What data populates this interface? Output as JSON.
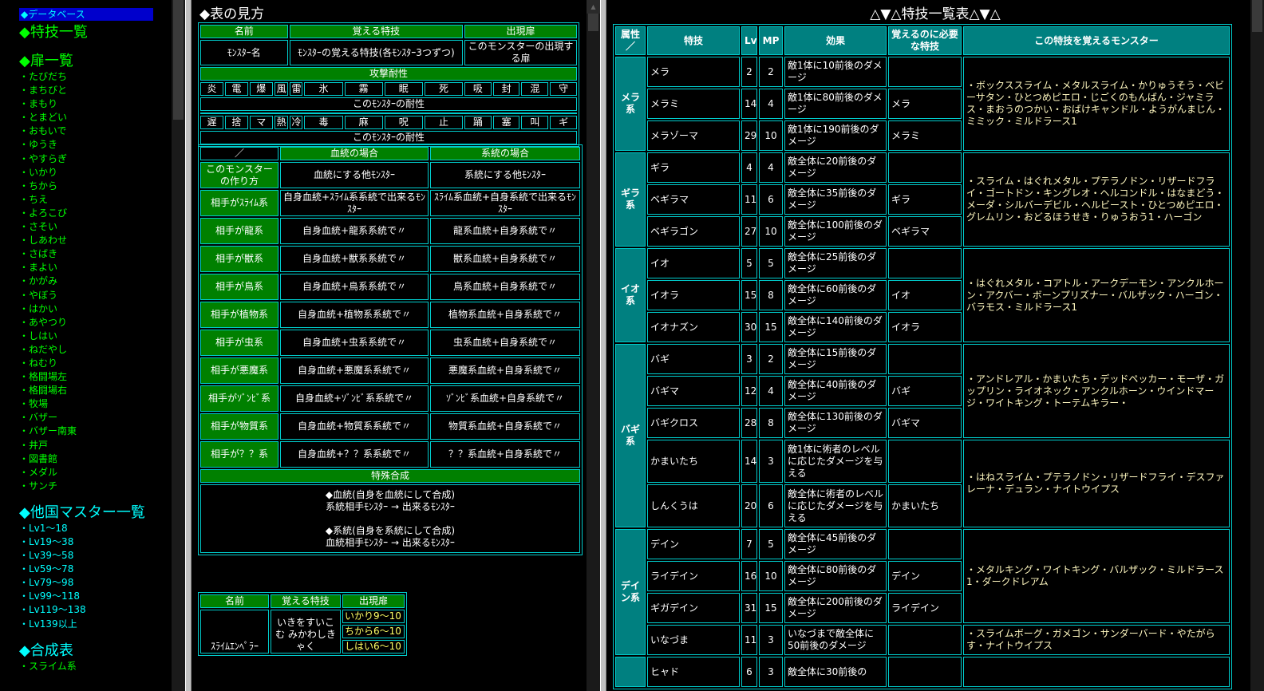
{
  "sidebar": {
    "selected": "◆データベース",
    "skills_head": "◆特技一覧",
    "doors_head": "◆扉一覧",
    "doors": [
      "・たびだち",
      "・まちびと",
      "・まもり",
      "・とまどい",
      "・おもいで",
      "・ゆうき",
      "・やすらぎ",
      "・いかり",
      "・ちから",
      "・ちえ",
      "・よろこび",
      "・さそい",
      "・しあわせ",
      "・さばき",
      "・まよい",
      "・かがみ",
      "・やぼう",
      "・はかい",
      "・あやつり",
      "・しはい",
      "・ねだやし",
      "・ねむり",
      "・格闘場左",
      "・格闘場右",
      "・牧場",
      "・バザー",
      "・バザー南東",
      "・井戸",
      "・図書館",
      "・メダル",
      "・サンチ"
    ],
    "masters_head": "◆他国マスター一覧",
    "masters": [
      "・Lv1～18",
      "・Lv19～38",
      "・Lv39～58",
      "・Lv59～78",
      "・Lv79～98",
      "・Lv99～118",
      "・Lv119～138",
      "・Lv139以上"
    ],
    "synth_head": "◆合成表",
    "synth": [
      "・スライム系"
    ]
  },
  "legend": {
    "title": "◆表の見方",
    "h_name": "名前",
    "h_skill": "覚える特技",
    "h_door": "出現扉",
    "c_name": "ﾓﾝｽﾀｰ名",
    "c_skill": "ﾓﾝｽﾀｰの覚える特技(各ﾓﾝｽﾀｰ3つずつ)",
    "c_door": "このモンスターの出現する扉",
    "attack_res": "攻撃耐性",
    "attack_cells": [
      "炎",
      "電",
      "爆",
      "風",
      "雷",
      "氷",
      "霧",
      "眠",
      "死",
      "吸",
      "封",
      "混",
      "守"
    ],
    "res_label": "このﾓﾝｽﾀｰの耐性",
    "status_cells": [
      "遅",
      "捨",
      "マ",
      "熱",
      "冷",
      "毒",
      "麻",
      "呪",
      "止",
      "踊",
      "塞",
      "叫",
      "ギ"
    ],
    "res_label2": "このﾓﾝｽﾀｰの耐性",
    "slash": "／",
    "h_blood": "血統の場合",
    "h_line": "系統の場合",
    "make_label": "このモンスターの作り方",
    "make_blood": "血統にする他ﾓﾝｽﾀｰ",
    "make_line": "系統にする他ﾓﾝｽﾀｰ",
    "rows": [
      {
        "label": "相手がｽﾗｲﾑ系",
        "blood": "自身血統+ｽﾗｲﾑ系系統で出来るﾓﾝｽﾀｰ",
        "line": "ｽﾗｲﾑ系血統+自身系統で出来るﾓﾝｽﾀｰ"
      },
      {
        "label": "相手が龍系",
        "blood": "自身血統+龍系系統で〃",
        "line": "龍系血統+自身系統で〃"
      },
      {
        "label": "相手が獣系",
        "blood": "自身血統+獣系系統で〃",
        "line": "獣系血統+自身系統で〃"
      },
      {
        "label": "相手が鳥系",
        "blood": "自身血統+鳥系系統で〃",
        "line": "鳥系血統+自身系統で〃"
      },
      {
        "label": "相手が植物系",
        "blood": "自身血統+植物系系統で〃",
        "line": "植物系血統+自身系統で〃"
      },
      {
        "label": "相手が虫系",
        "blood": "自身血統+虫系系統で〃",
        "line": "虫系血統+自身系統で〃"
      },
      {
        "label": "相手が悪魔系",
        "blood": "自身血統+悪魔系系統で〃",
        "line": "悪魔系血統+自身系統で〃"
      },
      {
        "label": "相手がｿﾞﾝﾋﾞ系",
        "blood": "自身血統+ｿﾞﾝﾋﾞ系系統で〃",
        "line": "ｿﾞﾝﾋﾞ系血統+自身系統で〃"
      },
      {
        "label": "相手が物質系",
        "blood": "自身血統+物質系系統で〃",
        "line": "物質系血統+自身系統で〃"
      },
      {
        "label": "相手が？？系",
        "blood": "自身血統+？？系系統で〃",
        "line": "？？系血統+自身系統で〃"
      }
    ],
    "special": "特殊合成",
    "sp1": "◆血統(自身を血統にして合成)",
    "sp2": "系統相手ﾓﾝｽﾀｰ → 出来るﾓﾝｽﾀｰ",
    "sp3": "◆系統(自身を系統にして合成)",
    "sp4": "血統相手ﾓﾝｽﾀｰ → 出来るﾓﾝｽﾀｰ"
  },
  "monster": {
    "h_name": "名前",
    "h_skill": "覚える特技",
    "h_door": "出現扉",
    "name_part": "ｽﾗｲﾑｴﾝﾍﾟﾗｰ",
    "skill_part": "いきをすいこむ みかわしきゃく",
    "doors": [
      "いかり9～10",
      "ちから6～10",
      "しはい6～10"
    ]
  },
  "skills": {
    "title": "△▼△特技一覧表△▼△",
    "headers": [
      "属性／",
      "特技",
      "Lv",
      "MP",
      "効果",
      "覚えるのに必要な特技",
      "この特技を覚えるモンスター"
    ],
    "groups": [
      {
        "attr": "メラ系",
        "monsters": "・ボックススライム・メタルスライム・かりゅうそう・ベビーサタン・ひとつめピエロ・じごくのもんばん・ジャミラス・まおうのつかい・おばけキャンドル・ようがんまじん・ミミック・ミルドラース1",
        "rows": [
          [
            "メラ",
            "2",
            "2",
            "敵1体に10前後のダメージ",
            ""
          ],
          [
            "メラミ",
            "14",
            "4",
            "敵1体に80前後のダメージ",
            "メラ"
          ],
          [
            "メラゾーマ",
            "29",
            "10",
            "敵1体に190前後のダメージ",
            "メラミ"
          ]
        ]
      },
      {
        "attr": "ギラ系",
        "monsters": "・スライム・はぐれメタル・プテラノドン・リザードフライ・ゴートドン・キングレオ・ヘルコンドル・はなまどう・メーダ・シルバーデビル・ヘルビースト・ひとつめピエロ・グレムリン・おどるほうせき・りゅうおう1・ハーゴン",
        "rows": [
          [
            "ギラ",
            "4",
            "4",
            "敵全体に20前後のダメージ",
            ""
          ],
          [
            "ベギラマ",
            "11",
            "6",
            "敵全体に35前後のダメージ",
            "ギラ"
          ],
          [
            "ベギラゴン",
            "27",
            "10",
            "敵全体に100前後のダメージ",
            "ベギラマ"
          ]
        ]
      },
      {
        "attr": "イオ系",
        "monsters": "・はぐれメタル・コアトル・アークデーモン・アンクルホーン・アクバー・ボーンプリズナー・バルザック・ハーゴン・バラモス・ミルドラース1",
        "rows": [
          [
            "イオ",
            "5",
            "5",
            "敵全体に25前後のダメージ",
            ""
          ],
          [
            "イオラ",
            "15",
            "8",
            "敵全体に60前後のダメージ",
            "イオ"
          ],
          [
            "イオナズン",
            "30",
            "15",
            "敵全体に140前後のダメージ",
            "イオラ"
          ]
        ]
      },
      {
        "attr": "バギ系",
        "monsters": "・アンドレアル・かまいたち・デッドペッカー・モーザ・ガップリン・ライオネック・アンクルホーン・ウインドマージ・ワイトキング・トーテムキラー・",
        "monsters2": "・はねスライム・プテラノドン・リザードフライ・デスファレーナ・デュラン・ナイトウイプス",
        "rows": [
          [
            "バギ",
            "3",
            "2",
            "敵全体に15前後のダメージ",
            ""
          ],
          [
            "バギマ",
            "12",
            "4",
            "敵全体に40前後のダメージ",
            "バギ"
          ],
          [
            "バギクロス",
            "28",
            "8",
            "敵全体に130前後のダメージ",
            "バギマ"
          ],
          [
            "かまいたち",
            "14",
            "3",
            "敵1体に術者のレベルに応じたダメージを与える",
            ""
          ],
          [
            "しんくうは",
            "20",
            "6",
            "敵全体に術者のレベルに応じたダメージを与える",
            "かまいたち"
          ]
        ]
      },
      {
        "attr": "デイン系",
        "monsters": "・メタルキング・ワイトキング・バルザック・ミルドラース1・ダークドレアム",
        "monsters2": "・スライムボーグ・ガメゴン・サンダーバード・やたがらす・ナイトウイプス",
        "rows": [
          [
            "デイン",
            "7",
            "5",
            "敵全体に45前後のダメージ",
            ""
          ],
          [
            "ライデイン",
            "16",
            "10",
            "敵全体に80前後のダメージ",
            "デイン"
          ],
          [
            "ギガデイン",
            "31",
            "15",
            "敵全体に200前後のダメージ",
            "ライデイン"
          ],
          [
            "いなづま",
            "11",
            "3",
            "いなづまで敵全体に50前後のダメージ",
            ""
          ]
        ]
      },
      {
        "attr": "",
        "rows": [
          [
            "ヒャド",
            "6",
            "3",
            "敵全体に30前後の",
            ""
          ]
        ]
      }
    ]
  }
}
